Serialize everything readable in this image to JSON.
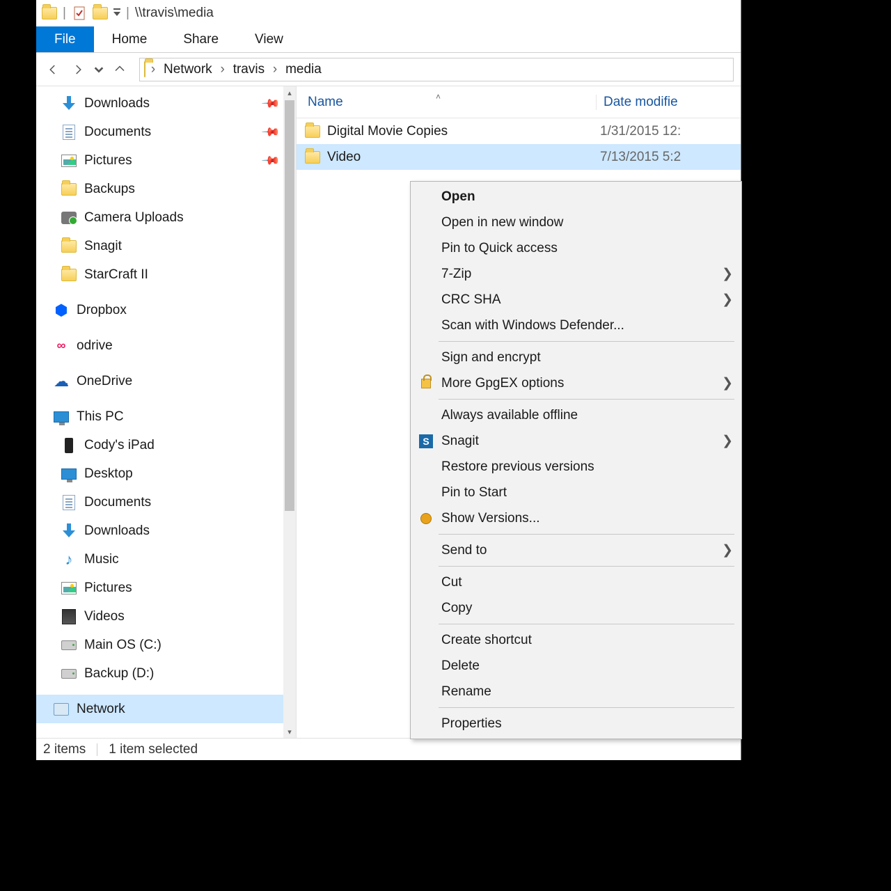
{
  "titlebar": {
    "path": "\\\\travis\\media"
  },
  "tabs": {
    "file": "File",
    "home": "Home",
    "share": "Share",
    "view": "View"
  },
  "breadcrumb": {
    "root": "Network",
    "seg1": "travis",
    "seg2": "media"
  },
  "navtree": {
    "downloads": "Downloads",
    "documents": "Documents",
    "pictures": "Pictures",
    "backups": "Backups",
    "camera_uploads": "Camera Uploads",
    "snagit": "Snagit",
    "starcraft": "StarCraft II",
    "dropbox": "Dropbox",
    "odrive": "odrive",
    "onedrive": "OneDrive",
    "this_pc": "This PC",
    "codys_ipad": "Cody's iPad",
    "desktop": "Desktop",
    "documents2": "Documents",
    "downloads2": "Downloads",
    "music": "Music",
    "pictures2": "Pictures",
    "videos": "Videos",
    "main_os": "Main OS (C:)",
    "backup_d": "Backup (D:)",
    "network": "Network"
  },
  "columns": {
    "name": "Name",
    "date": "Date modifie"
  },
  "rows": [
    {
      "name": "Digital Movie Copies",
      "date": "1/31/2015 12:"
    },
    {
      "name": "Video",
      "date": "7/13/2015 5:2"
    }
  ],
  "status": {
    "items": "2 items",
    "selected": "1 item selected"
  },
  "ctx": {
    "open": "Open",
    "open_new_window": "Open in new window",
    "pin_quick": "Pin to Quick access",
    "seven_zip": "7-Zip",
    "crc_sha": "CRC SHA",
    "defender": "Scan with Windows Defender...",
    "sign_encrypt": "Sign and encrypt",
    "gpgex": "More GpgEX options",
    "offline": "Always available offline",
    "snagit": "Snagit",
    "restore_prev": "Restore previous versions",
    "pin_start": "Pin to Start",
    "show_versions": "Show Versions...",
    "send_to": "Send to",
    "cut": "Cut",
    "copy": "Copy",
    "shortcut": "Create shortcut",
    "delete": "Delete",
    "rename": "Rename",
    "properties": "Properties"
  }
}
